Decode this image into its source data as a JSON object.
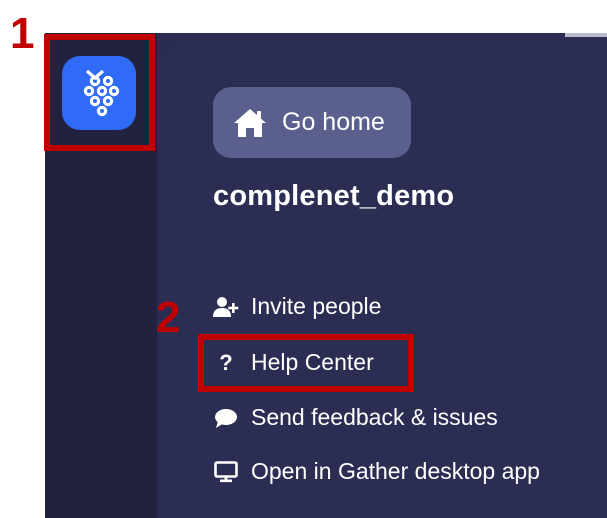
{
  "app": {
    "logo_icon": "gather-grapes-icon"
  },
  "panel": {
    "go_home_label": "Go home",
    "space_name": "complenet_demo",
    "menu": [
      {
        "icon": "add-user-icon",
        "label": "Invite people"
      },
      {
        "icon": "question-icon",
        "label": "Help Center"
      },
      {
        "icon": "chat-bubble-icon",
        "label": "Send feedback & issues"
      },
      {
        "icon": "monitor-icon",
        "label": "Open in Gather desktop app"
      }
    ]
  },
  "annotations": {
    "marker_1": "1",
    "marker_2": "2"
  },
  "colors": {
    "sidebar": "#202240",
    "panel": "#2b2e52",
    "go_home_bg": "#5b5f8e",
    "logo_bg": "#2f6bf6",
    "annotation": "#c00000"
  }
}
